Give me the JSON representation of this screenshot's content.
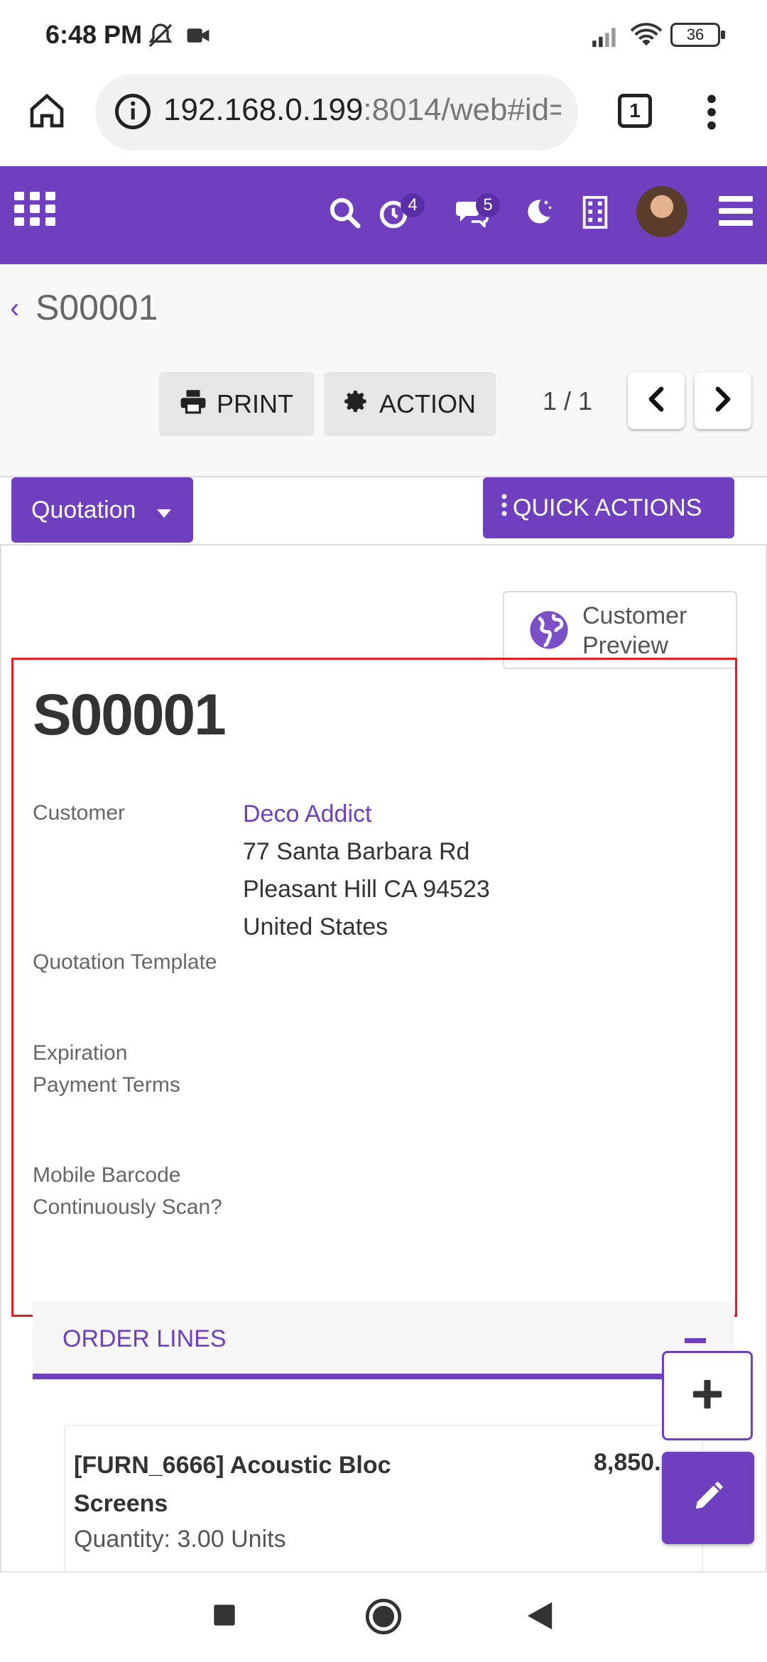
{
  "status_bar": {
    "time": "6:48 PM",
    "battery": "36"
  },
  "browser": {
    "url_host": "192.168.0.199",
    "url_rest": ":8014/web#id=",
    "tab_count": "1"
  },
  "header": {
    "activity_badge": "4",
    "messages_badge": "5"
  },
  "breadcrumb": {
    "title": "S00001"
  },
  "toolbar": {
    "print_label": "PRINT",
    "action_label": "ACTION",
    "pager": "1 / 1"
  },
  "status": {
    "stage_label": "Quotation",
    "quick_actions_label": "QUICK ACTIONS"
  },
  "form": {
    "customer_preview_line1": "Customer",
    "customer_preview_line2": "Preview",
    "order_ref": "S00001",
    "customer_label": "Customer",
    "customer_name": "Deco Addict",
    "address_line1": "77 Santa Barbara Rd",
    "address_line2": "Pleasant Hill CA 94523",
    "address_line3": "United States",
    "quotation_template_label": "Quotation Template",
    "expiration_label": "Expiration",
    "payment_terms_label": "Payment Terms",
    "mobile_barcode_label": "Mobile Barcode",
    "continuously_scan_label": "Continuously Scan?"
  },
  "order_lines": {
    "section_title": "ORDER LINES",
    "items": [
      {
        "name": "[FURN_6666] Acoustic Bloc Screens",
        "price": "8,850.",
        "quantity": "Quantity: 3.00 Units"
      }
    ]
  },
  "colors": {
    "brand": "#6f3fbf",
    "highlight_border": "#e02020"
  }
}
